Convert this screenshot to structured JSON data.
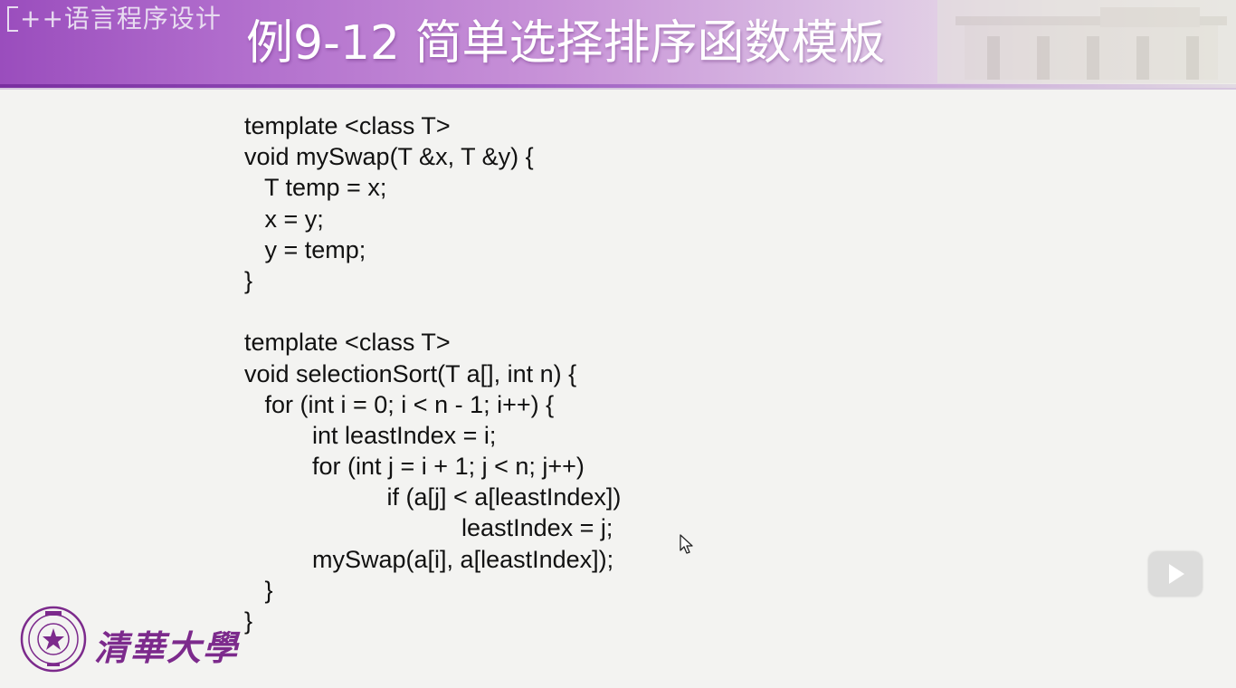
{
  "header": {
    "course_tag": "++语言程序设计",
    "title": "例9-12 简单选择排序函数模板"
  },
  "code": {
    "lines": [
      "template <class T>",
      "void mySwap(T &x, T &y) {",
      "   T temp = x;",
      "   x = y;",
      "   y = temp;",
      "}",
      "",
      "template <class T>",
      "void selectionSort(T a[], int n) {",
      "   for (int i = 0; i < n - 1; i++) {",
      "          int leastIndex = i;",
      "          for (int j = i + 1; j < n; j++)",
      "                     if (a[j] < a[leastIndex])",
      "                                leastIndex = j;",
      "          mySwap(a[i], a[leastIndex]);",
      "   }",
      "}"
    ]
  },
  "footer": {
    "logo_text": "清華大學"
  },
  "colors": {
    "header_purple": "#9a4dbd",
    "logo_purple": "#7c2a8c",
    "code_text": "#111111"
  },
  "icons": {
    "play": "play-icon",
    "cursor": "mouse-pointer-icon"
  }
}
